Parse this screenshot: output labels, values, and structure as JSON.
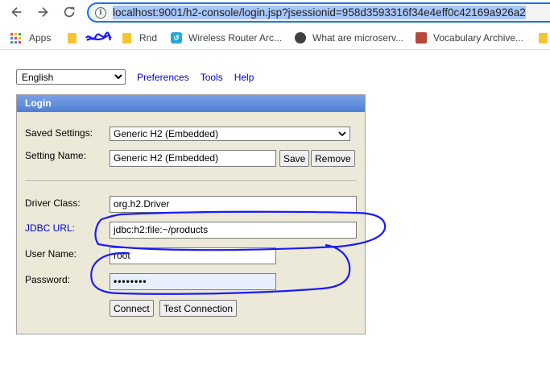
{
  "browser": {
    "url": "localhost:9001/h2-console/login.jsp?jsessionid=958d3593316f34e4eff0c42169a926a2",
    "bookmarks": [
      {
        "label": "Apps",
        "icon": "apps-grid-icon"
      },
      {
        "label": "",
        "icon": "folder-icon"
      },
      {
        "label": "Rnd",
        "icon": "folder-icon"
      },
      {
        "label": "Wireless Router Arc...",
        "icon": "router-site-icon"
      },
      {
        "label": "What are microserv...",
        "icon": "globe-icon"
      },
      {
        "label": "Vocabulary Archive...",
        "icon": "book-site-icon"
      }
    ]
  },
  "top": {
    "language": "English",
    "links": [
      "Preferences",
      "Tools",
      "Help"
    ]
  },
  "login": {
    "title": "Login",
    "saved_settings_label": "Saved Settings:",
    "saved_settings_value": "Generic H2 (Embedded)",
    "setting_name_label": "Setting Name:",
    "setting_name_value": "Generic H2 (Embedded)",
    "save_label": "Save",
    "remove_label": "Remove",
    "driver_class_label": "Driver Class:",
    "driver_class_value": "org.h2.Driver",
    "jdbc_url_label": "JDBC URL:",
    "jdbc_url_value": "jdbc:h2:file:~/products",
    "user_name_label": "User Name:",
    "user_name_value": "root",
    "password_label": "Password:",
    "password_value": "••••••••",
    "connect_label": "Connect",
    "test_label": "Test Connection"
  },
  "colors": {
    "annotation": "#1a1aff",
    "panel_bg": "#ece9d8",
    "header": "#5b8ad8",
    "link": "#0000cc"
  }
}
